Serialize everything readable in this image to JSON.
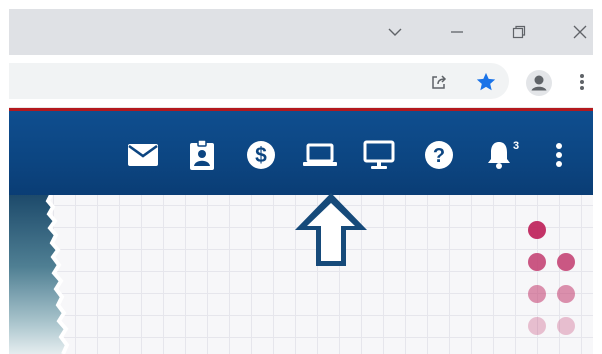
{
  "window": {
    "controls": [
      "chevron-down-icon",
      "minimize-icon",
      "restore-icon",
      "close-icon"
    ]
  },
  "toolbar": {
    "icons": [
      "share-icon",
      "bookmark-star-icon",
      "profile-icon",
      "browser-menu-icon"
    ],
    "accent": "#1a73e8"
  },
  "nav": {
    "icons": [
      "mail-icon",
      "contact-card-icon",
      "dollar-icon",
      "laptop-icon",
      "monitor-icon",
      "help-icon",
      "bell-icon",
      "kebab-menu-icon"
    ],
    "notifications_count": "3",
    "bar_color": "#0c4581",
    "accent_line": "#b3191e"
  },
  "content": {
    "dot_color": "#c23b6e"
  },
  "annotation": {
    "icon": "up-arrow-icon",
    "points_to": "laptop-icon"
  }
}
